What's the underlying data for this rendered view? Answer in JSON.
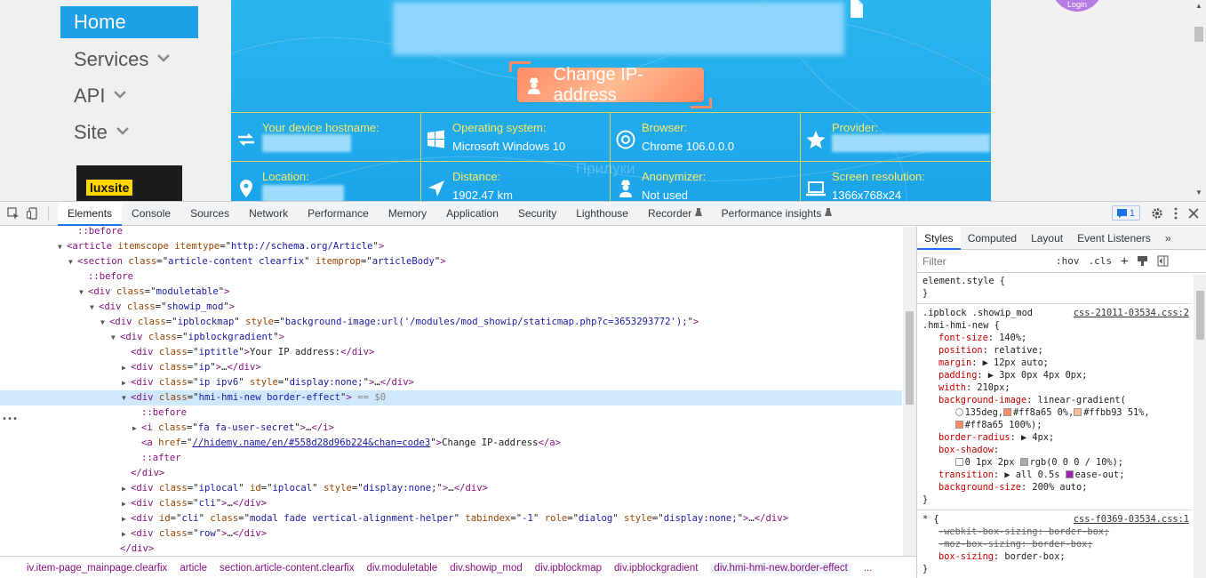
{
  "site": {
    "nav": [
      {
        "label": "Home",
        "active": true,
        "has_chevron": false
      },
      {
        "label": "Services",
        "active": false,
        "has_chevron": true
      },
      {
        "label": "API",
        "active": false,
        "has_chevron": true
      },
      {
        "label": "Site",
        "active": false,
        "has_chevron": true
      }
    ],
    "ad_label": "luxsite",
    "avatar_label": "Login",
    "change_ip_label": "Change IP-address",
    "watermark": "Прилуки",
    "cells": [
      {
        "label": "Your device hostname:",
        "value": "",
        "icon": "refresh-arrows-icon",
        "blurred": true
      },
      {
        "label": "Operating system:",
        "value": "Microsoft Windows 10",
        "icon": "windows-icon",
        "blurred": false
      },
      {
        "label": "Browser:",
        "value": "Chrome 106.0.0.0",
        "icon": "chrome-icon",
        "blurred": false
      },
      {
        "label": "Provider:",
        "value": "",
        "icon": "star-icon",
        "blurred": true
      },
      {
        "label": "Location:",
        "value": "",
        "icon": "location-pin-icon",
        "blurred": true
      },
      {
        "label": "Distance:",
        "value": "1902.47 km",
        "icon": "navigation-arrow-icon",
        "blurred": false
      },
      {
        "label": "Anonymizer:",
        "value": "Not used",
        "icon": "user-secret-icon",
        "blurred": false
      },
      {
        "label": "Screen resolution:",
        "value": "1366x768x24",
        "icon": "laptop-icon",
        "blurred": false
      }
    ],
    "colors": {
      "hero": "#1ca5ea",
      "accent_yellow": "#f8ea67",
      "button": "#ff8a65"
    }
  },
  "devtools": {
    "tabs": [
      "Elements",
      "Console",
      "Sources",
      "Network",
      "Performance",
      "Memory",
      "Application",
      "Security",
      "Lighthouse",
      "Recorder",
      "Performance insights"
    ],
    "active_tab": "Elements",
    "issues_count": "1",
    "crumbs": [
      "iv.item-page_mainpage.clearfix",
      "article",
      "section.article-content.clearfix",
      "div.moduletable",
      "div.showip_mod",
      "div.ipblockmap",
      "div.ipblockgradient",
      "div.hmi-hmi-new.border-effect"
    ],
    "crumbs_more": "...",
    "styles_tabs": [
      "Styles",
      "Computed",
      "Layout",
      "Event Listeners"
    ],
    "filter_placeholder": "Filter",
    "hov_label": ":hov",
    "cls_label": ".cls"
  },
  "dom_lines": [
    {
      "depth": 5,
      "tri": "",
      "html": "<span class=\"pseudo\">::before</span>"
    },
    {
      "depth": 4,
      "tri": "▼",
      "html": "<span class=\"tag\">&lt;article</span> <span class=\"attr\">itemscope</span> <span class=\"attr\">itemtype</span>=\"<span class=\"val\">http://schema.org/Article</span>\"<span class=\"tag\">&gt;</span>"
    },
    {
      "depth": 5,
      "tri": "▼",
      "html": "<span class=\"tag\">&lt;section</span> <span class=\"attr\">class</span>=\"<span class=\"val\">article-content clearfix</span>\" <span class=\"attr\">itemprop</span>=\"<span class=\"val\">articleBody</span>\"<span class=\"tag\">&gt;</span>"
    },
    {
      "depth": 6,
      "tri": "",
      "html": "<span class=\"pseudo\">::before</span>"
    },
    {
      "depth": 6,
      "tri": "▼",
      "html": "<span class=\"tag\">&lt;div</span> <span class=\"attr\">class</span>=\"<span class=\"val\">moduletable</span>\"<span class=\"tag\">&gt;</span>"
    },
    {
      "depth": 7,
      "tri": "▼",
      "html": "<span class=\"tag\">&lt;div</span> <span class=\"attr\">class</span>=\"<span class=\"val\">showip_mod</span>\"<span class=\"tag\">&gt;</span>"
    },
    {
      "depth": 8,
      "tri": "▼",
      "html": "<span class=\"tag\">&lt;div</span> <span class=\"attr\">class</span>=\"<span class=\"val\">ipblockmap</span>\" <span class=\"attr\">style</span>=\"<span class=\"val\">background-image:url('/modules/mod_showip/staticmap.php?c=3653293772');</span>\"<span class=\"tag\">&gt;</span>"
    },
    {
      "depth": 9,
      "tri": "▼",
      "html": "<span class=\"tag\">&lt;div</span> <span class=\"attr\">class</span>=\"<span class=\"val\">ipblockgradient</span>\"<span class=\"tag\">&gt;</span>"
    },
    {
      "depth": 10,
      "tri": "",
      "html": "<span class=\"tag\">&lt;div</span> <span class=\"attr\">class</span>=\"<span class=\"val\">iptitle</span>\"<span class=\"tag\">&gt;</span>Your IP address:<span class=\"tag\">&lt;/div&gt;</span>"
    },
    {
      "depth": 10,
      "tri": "▶",
      "html": "<span class=\"tag\">&lt;div</span> <span class=\"attr\">class</span>=\"<span class=\"val\">ip</span>\"<span class=\"tag\">&gt;</span>…<span class=\"tag\">&lt;/div&gt;</span>"
    },
    {
      "depth": 10,
      "tri": "▶",
      "html": "<span class=\"tag\">&lt;div</span> <span class=\"attr\">class</span>=\"<span class=\"val\">ip ipv6</span>\" <span class=\"attr\">style</span>=\"<span class=\"val\">display:none;</span>\"<span class=\"tag\">&gt;</span>…<span class=\"tag\">&lt;/div&gt;</span>"
    },
    {
      "depth": 10,
      "tri": "▼",
      "selected": true,
      "html": "<span class=\"tag\">&lt;div</span> <span class=\"attr\">class</span>=\"<span class=\"val\">hmi-hmi-new border-effect</span>\"<span class=\"tag\">&gt;</span> <span class=\"dimc\">== $0</span>"
    },
    {
      "depth": 11,
      "tri": "",
      "html": "<span class=\"pseudo\">::before</span>"
    },
    {
      "depth": 11,
      "tri": "▶",
      "html": "<span class=\"tag\">&lt;i</span> <span class=\"attr\">class</span>=\"<span class=\"val\">fa fa-user-secret</span>\"<span class=\"tag\">&gt;</span>…<span class=\"tag\">&lt;/i&gt;</span>"
    },
    {
      "depth": 11,
      "tri": "",
      "html": "<span class=\"tag\">&lt;a</span> <span class=\"attr\">href</span>=\"<span class=\"link\">//hidemy.name/en/#558d28d96b224&amp;chan=code3</span>\"<span class=\"tag\">&gt;</span>Change IP-address<span class=\"tag\">&lt;/a&gt;</span>"
    },
    {
      "depth": 11,
      "tri": "",
      "html": "<span class=\"pseudo\">::after</span>"
    },
    {
      "depth": 10,
      "tri": "",
      "html": "<span class=\"tag\">&lt;/div&gt;</span>"
    },
    {
      "depth": 10,
      "tri": "▶",
      "html": "<span class=\"tag\">&lt;div</span> <span class=\"attr\">class</span>=\"<span class=\"val\">iplocal</span>\" <span class=\"attr\">id</span>=\"<span class=\"val\">iplocal</span>\" <span class=\"attr\">style</span>=\"<span class=\"val\">display:none;</span>\"<span class=\"tag\">&gt;</span>…<span class=\"tag\">&lt;/div&gt;</span>"
    },
    {
      "depth": 10,
      "tri": "▶",
      "html": "<span class=\"tag\">&lt;div</span> <span class=\"attr\">class</span>=\"<span class=\"val\">cli</span>\"<span class=\"tag\">&gt;</span>…<span class=\"tag\">&lt;/div&gt;</span>"
    },
    {
      "depth": 10,
      "tri": "▶",
      "html": "<span class=\"tag\">&lt;div</span> <span class=\"attr\">id</span>=\"<span class=\"val\">cli</span>\" <span class=\"attr\">class</span>=\"<span class=\"val\">modal fade vertical-alignment-helper</span>\" <span class=\"attr\">tabindex</span>=\"<span class=\"val\">-1</span>\" <span class=\"attr\">role</span>=\"<span class=\"val\">dialog</span>\" <span class=\"attr\">style</span>=\"<span class=\"val\">display:none;</span>\"<span class=\"tag\">&gt;</span>…<span class=\"tag\">&lt;/div&gt;</span>"
    },
    {
      "depth": 10,
      "tri": "▶",
      "html": "<span class=\"tag\">&lt;div</span> <span class=\"attr\">class</span>=\"<span class=\"val\">row</span>\"<span class=\"tag\">&gt;</span>…<span class=\"tag\">&lt;/div&gt;</span>"
    },
    {
      "depth": 9,
      "tri": "",
      "html": "<span class=\"tag\">&lt;/div&gt;</span>"
    }
  ],
  "style_lines": [
    {
      "cls": "",
      "html": "element.style {"
    },
    {
      "cls": "",
      "html": "}"
    },
    {
      "sep": true
    },
    {
      "cls": "",
      "html": ".ipblock .showip_mod",
      "src": "css-21011-03534.css:2"
    },
    {
      "cls": "",
      "html": ".hmi-hmi-new {"
    },
    {
      "cls": "ind",
      "html": "<span class=\"prop\">font-size</span>: 140%;"
    },
    {
      "cls": "ind",
      "html": "<span class=\"prop\">position</span>: relative;"
    },
    {
      "cls": "ind",
      "html": "<span class=\"prop\">margin</span>: ▶ 12px auto;"
    },
    {
      "cls": "ind",
      "html": "<span class=\"prop\">padding</span>: ▶ 3px 0px 4px 0px;"
    },
    {
      "cls": "ind",
      "html": "<span class=\"prop\">width</span>: 210px;"
    },
    {
      "cls": "ind",
      "html": "<span class=\"prop\">background-image</span>: linear-gradient("
    },
    {
      "cls": "ind",
      "html": "&nbsp;&nbsp;&nbsp;<span class=\"swatch\" style=\"border-radius:50%;background:#fff\"></span>135deg,<span class=\"swatch\" style=\"background:#ff8a65\"></span>#ff8a65 0%,<span class=\"swatch\" style=\"background:#ffbb93\"></span>#ffbb93 51%,"
    },
    {
      "cls": "ind",
      "html": "&nbsp;&nbsp;&nbsp;<span class=\"swatch\" style=\"background:#ff8a65\"></span>#ff8a65 100%);"
    },
    {
      "cls": "ind",
      "html": "<span class=\"prop\">border-radius</span>: ▶ 4px;"
    },
    {
      "cls": "ind",
      "html": "<span class=\"prop\">box-shadow</span>:"
    },
    {
      "cls": "ind",
      "html": "&nbsp;&nbsp;&nbsp;<span class=\"swatch\" style=\"background:#fff\"></span>0 1px 2px <span class=\"swatch\" style=\"background:#aaa\"></span>rgb(0 0 0 / 10%);"
    },
    {
      "cls": "ind",
      "html": "<span class=\"prop\">transition</span>: ▶ all 0.5s <span class=\"swatch\" style=\"background:#9c27b0\"></span>ease-out;"
    },
    {
      "cls": "ind",
      "html": "<span class=\"prop\">background-size</span>: 200% auto;"
    },
    {
      "cls": "",
      "html": "}"
    },
    {
      "sep": true
    },
    {
      "cls": "",
      "html": "* {",
      "src": "css-f0369-03534.css:1"
    },
    {
      "cls": "ind",
      "html": "<span class=\"strike\">-webkit-box-sizing: border-box;</span>"
    },
    {
      "cls": "ind",
      "html": "<span class=\"strike\">-moz-box-sizing: border-box;</span>"
    },
    {
      "cls": "ind",
      "html": "<span class=\"prop\">box-sizing</span>: border-box;"
    },
    {
      "cls": "",
      "html": "}"
    }
  ]
}
